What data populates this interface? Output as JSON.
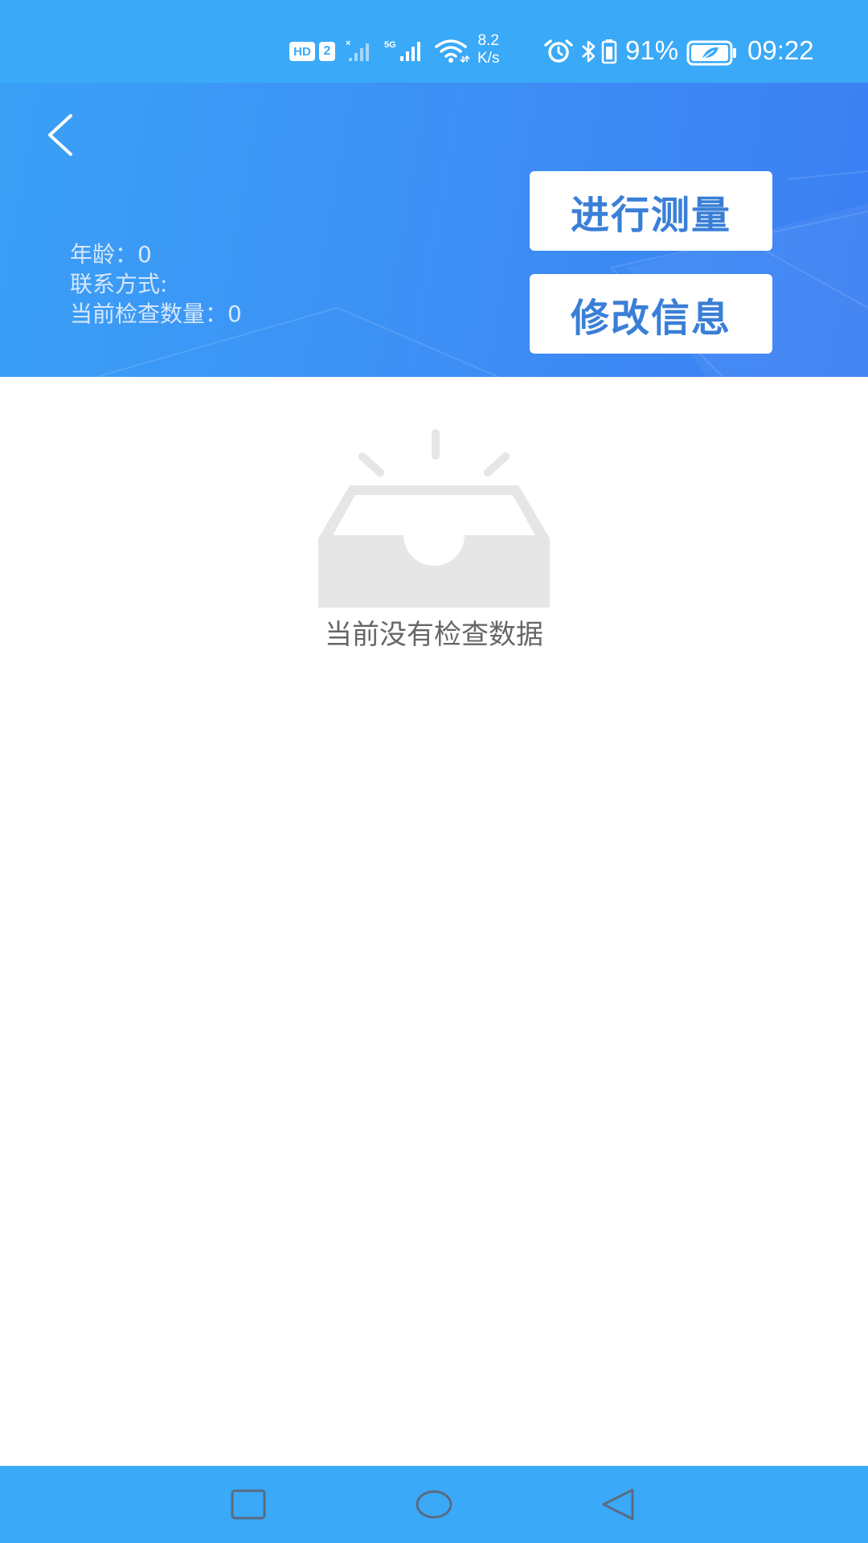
{
  "status_bar": {
    "hd_badge": "HD",
    "sim_badge": "2",
    "network_5g": "5G",
    "speed_value": "8.2",
    "speed_unit": "K/s",
    "battery_percent": "91%",
    "time": "09:22",
    "icons": [
      "signal-icon",
      "wifi-icon",
      "alarm-icon",
      "bluetooth-icon",
      "battery-icon"
    ]
  },
  "header": {
    "back_icon": "chevron-left-icon",
    "age_label": "年龄：",
    "age_value": "0",
    "contact_label": "联系方式:",
    "contact_value": "",
    "check_count_label": "当前检查数量：",
    "check_count_value": "0",
    "measure_button": "进行测量",
    "edit_button": "修改信息",
    "gradient_colors": [
      "#3aa0f6",
      "#3b7ff3"
    ],
    "button_text_color": "#3a7fd7"
  },
  "empty_state": {
    "icon": "empty-inbox-icon",
    "message": "当前没有检查数据"
  },
  "nav_bar": {
    "icons": [
      "recent-apps-icon",
      "home-icon",
      "back-icon"
    ],
    "color": "#3aa9f7"
  }
}
